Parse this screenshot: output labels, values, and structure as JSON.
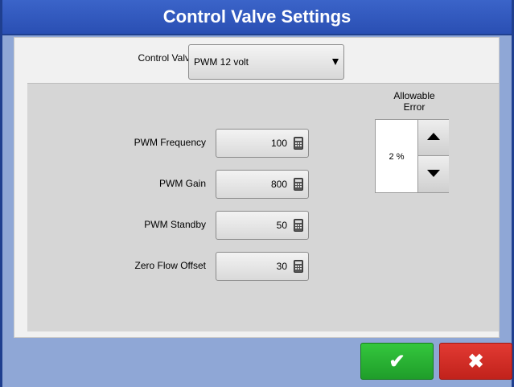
{
  "title": "Control Valve Settings",
  "control_valve": {
    "label": "Control Valve:",
    "value": "PWM 12 volt",
    "dropdown_icon": "triangle-down"
  },
  "fields": [
    {
      "label": "PWM Frequency",
      "value": "100",
      "icon": "calculator-icon"
    },
    {
      "label": "PWM Gain",
      "value": "800",
      "icon": "calculator-icon"
    },
    {
      "label": "PWM Standby",
      "value": "50",
      "icon": "calculator-icon"
    },
    {
      "label": "Zero Flow Offset",
      "value": "30",
      "icon": "calculator-icon"
    }
  ],
  "allowable_error": {
    "title_line1": "Allowable",
    "title_line2": "Error",
    "value": "2 %",
    "up_icon": "triangle-up",
    "down_icon": "triangle-down"
  },
  "actions": {
    "ok_symbol": "✔",
    "cancel_symbol": "✖"
  },
  "colors": {
    "titlebar": "#2a4fb3",
    "accent_green": "#1f9d2a",
    "accent_red": "#c1221b",
    "frame_background": "#8fa7d6"
  }
}
